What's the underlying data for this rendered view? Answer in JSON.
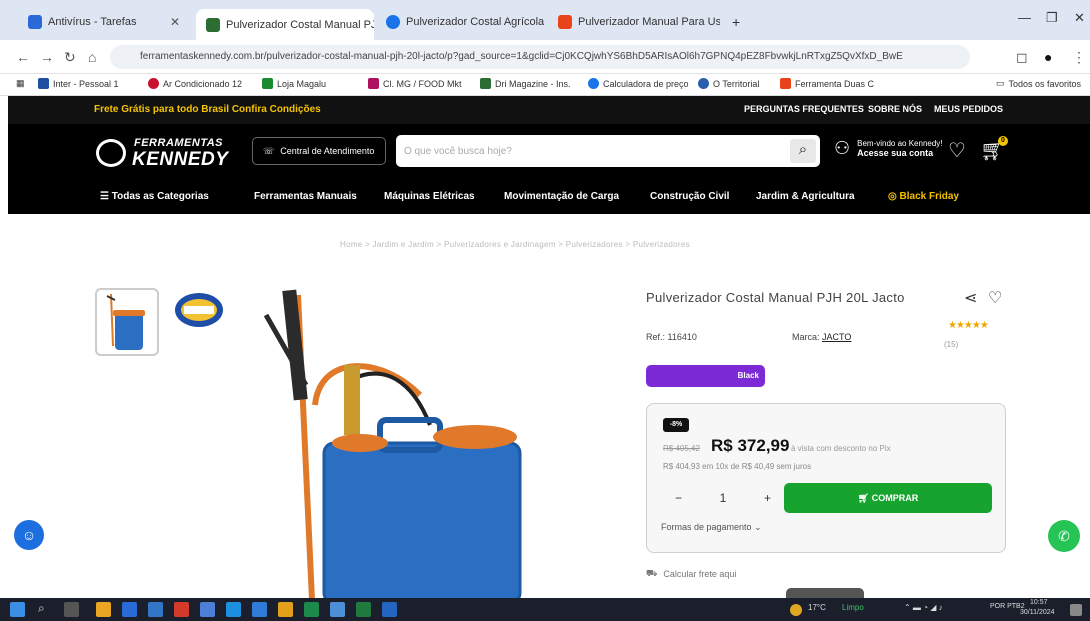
{
  "browser": {
    "tabs": [
      {
        "label": "Antivírus - Tarefas",
        "color": "#2a6ad8"
      },
      {
        "label": "Pulverizador Costal Manual PJH",
        "color": "#2b6d33"
      },
      {
        "label": "Pulverizador Costal Agrícola",
        "color": "#1a73e8"
      },
      {
        "label": "Pulverizador Manual Para Uso",
        "color": "#e8431a"
      }
    ],
    "new_tab": "+",
    "url": "ferramentaskennedy.com.br/pulverizador-costal-manual-pjh-20l-jacto/p?gad_source=1&gclid=Cj0KCQjwhYS6BhD5ARIsAOl6h7GPNQ4pEZ8FbvwkjLnRTxgZ5QvXfxD_BwE",
    "bookmarks": [
      "Inter - Pessoal 1",
      "Ar Condicionado 12",
      "Loja Magalu",
      "Cl. MG / FOOD Mkt",
      "Dri Magazine - Ins.",
      "Calculadora de preço",
      "O Territorial",
      "Ferramenta Duas C",
      "Todos os favoritos"
    ]
  },
  "site": {
    "promo": "Frete Grátis para todo Brasil Confira Condições",
    "top_links": [
      "PERGUNTAS FREQUENTES",
      "SOBRE NÓS",
      "MEUS PEDIDOS"
    ],
    "logo_line1": "FERRAMENTAS",
    "logo_line2": "KENNEDY",
    "service_btn": "Central de Atendimento",
    "search_placeholder": "O que você busca hoje?",
    "account_l1": "Bem-vindo ao Kennedy!",
    "account_l2": "Acesse sua conta",
    "cart_count": "0",
    "categories": [
      "Todas as Categorias",
      "Ferramentas Manuais",
      "Máquinas Elétricas",
      "Movimentação de Carga",
      "Construção Civil",
      "Jardim & Agricultura",
      "Black Friday"
    ]
  },
  "product": {
    "breadcrumb": "Home > Jardim e Jardim > Pulverizadores e Jardinagem > Pulverizadores > Pulverizadores",
    "title": "Pulverizador Costal Manual PJH 20L Jacto",
    "ref": "Ref.: 116410",
    "brand_label": "Marca:",
    "brand": "JACTO",
    "stars": "★★★★★",
    "reviews": "(15)",
    "badge": "Black",
    "discount": "-8%",
    "old_price": "R$ 405,42",
    "price": "R$ 372,99",
    "price_note": "à vista com desconto no Pix",
    "installments": "R$ 404,93 em 10x de R$ 40,49 sem juros",
    "quantity": "1",
    "qty_minus": "−",
    "qty_plus": "+",
    "buy_label": "COMPRAR",
    "payment_label": "Formas de pagamento",
    "shipping_label": "Calcular frete aqui"
  },
  "taskbar": {
    "weather": "17°C",
    "weather_desc": "Limpo",
    "lang": "POR PTB2",
    "time": "10:57",
    "date": "30/11/2024"
  }
}
